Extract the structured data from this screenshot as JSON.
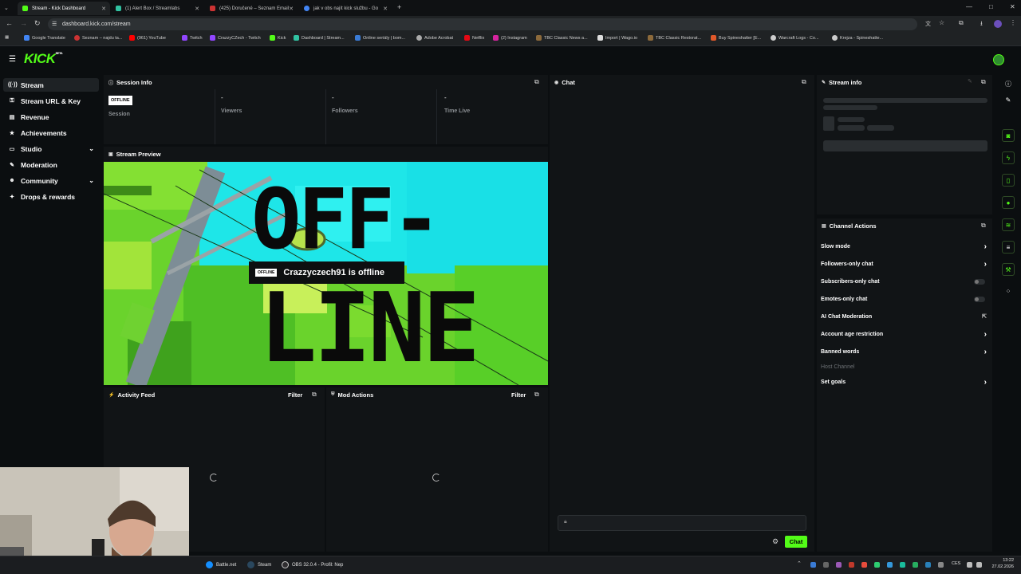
{
  "browser": {
    "tabs": [
      {
        "title": "Stream - Kick Dashboard",
        "active": true,
        "color": "#53fc18"
      },
      {
        "title": "(1) Alert Box / Streamlabs",
        "active": false,
        "color": "#31c3a2"
      },
      {
        "title": "(425) Doručené – Seznam Email",
        "active": false,
        "color": "#cc3333"
      },
      {
        "title": "jak v obs najít kick službu - Go",
        "active": false,
        "color": "#4285f4"
      }
    ],
    "url": "dashboard.kick.com/stream",
    "bookmarks": [
      "Google Translate",
      "Seznam – najdu ta...",
      "(961) YouTube",
      "Twitch",
      "CrazzyCZech - Twitch",
      "Kick",
      "Dashboard | Stream...",
      "Online seriály | bom...",
      "Adobe Acrobat",
      "Netflix",
      "(2) Instagram",
      "TBC Classic News a...",
      "Import | Wago.io",
      "TBC Classic Restorat...",
      "Buy Spineshatter [E...",
      "Warcraft Logs - Co...",
      "Krejza - Spineshatte..."
    ]
  },
  "brand": {
    "logo": "KICK",
    "beta": "BETA",
    "accent": "#53fc18"
  },
  "sidebar": {
    "items": [
      {
        "label": "Stream",
        "icon": "broadcast-icon",
        "glyph": "((·))"
      },
      {
        "label": "Stream URL & Key",
        "icon": "key-icon",
        "glyph": "⚿"
      },
      {
        "label": "Revenue",
        "icon": "revenue-icon",
        "glyph": "▤"
      },
      {
        "label": "Achievements",
        "icon": "trophy-icon",
        "glyph": "★"
      },
      {
        "label": "Studio",
        "icon": "studio-icon",
        "glyph": "▭"
      },
      {
        "label": "Moderation",
        "icon": "wrench-icon",
        "glyph": "✎"
      },
      {
        "label": "Community",
        "icon": "community-icon",
        "glyph": "☻"
      },
      {
        "label": "Drops & rewards",
        "icon": "gift-icon",
        "glyph": "✦"
      }
    ]
  },
  "session": {
    "title": "Session Info",
    "badge": "OFFLINE",
    "session_label": "Session",
    "stats": [
      {
        "value": "-",
        "label": "Viewers"
      },
      {
        "value": "-",
        "label": "Followers"
      },
      {
        "value": "-",
        "label": "Time Live"
      }
    ]
  },
  "preview": {
    "title": "Stream Preview",
    "art_text_1": "OFF-",
    "art_text_2": "LINE",
    "badge": "OFFLINE",
    "offline_message": "Crazzyczech91 is offline"
  },
  "activity": {
    "title": "Activity Feed",
    "filter": "Filter"
  },
  "mod": {
    "title": "Mod Actions",
    "filter": "Filter"
  },
  "chat": {
    "title": "Chat",
    "send": "Chat",
    "input_placeholder": ""
  },
  "stream_info": {
    "title": "Stream info"
  },
  "channel_actions": {
    "title": "Channel Actions",
    "items": [
      {
        "label": "Slow mode",
        "control": "arrow"
      },
      {
        "label": "Followers-only chat",
        "control": "arrow"
      },
      {
        "label": "Subscribers-only chat",
        "control": "toggle"
      },
      {
        "label": "Emotes-only chat",
        "control": "toggle"
      },
      {
        "label": "AI Chat Moderation",
        "control": "external"
      },
      {
        "label": "Account age restriction",
        "control": "arrow"
      },
      {
        "label": "Banned words",
        "control": "arrow"
      },
      {
        "label": "Host Channel",
        "control": "disabled"
      },
      {
        "label": "Set goals",
        "control": "arrow"
      }
    ]
  },
  "taskbar": {
    "items": [
      {
        "label": "Battle.net",
        "color": "#148eff"
      },
      {
        "label": "Steam",
        "color": "#1b2838"
      },
      {
        "label": "OBS 32.0.4 - Profil: Nep",
        "color": "#302e31"
      }
    ],
    "lang": "CES",
    "time": "13:22",
    "date": "27.02.2026"
  }
}
